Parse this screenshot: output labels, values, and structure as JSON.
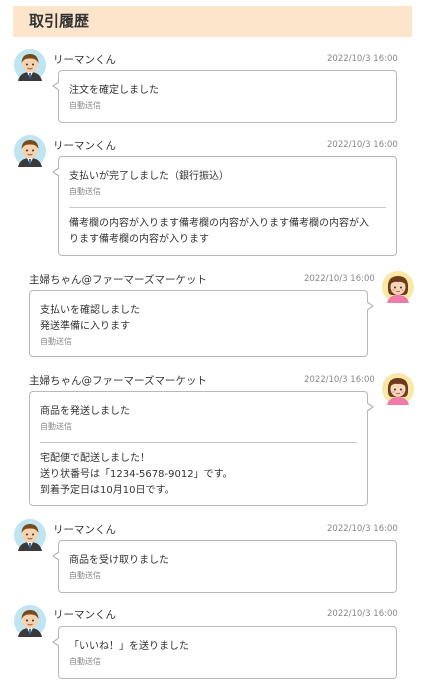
{
  "header": {
    "title": "取引履歴"
  },
  "messages": [
    {
      "sender": "リーマンくん",
      "time": "2022/10/3 16:00",
      "text": "注文を確定しました",
      "auto": "自動送信"
    },
    {
      "sender": "リーマンくん",
      "time": "2022/10/3 16:00",
      "text": "支払いが完了しました（銀行振込）",
      "auto": "自動送信",
      "note": "備考欄の内容が入ります備考欄の内容が入ります備考欄の内容が入\nります備考欄の内容が入ります"
    },
    {
      "sender": "主婦ちゃん@ファーマーズマーケット",
      "time": "2022/10/3 16:00",
      "text": "支払いを確認しました\n発送準備に入ります",
      "auto": "自動送信"
    },
    {
      "sender": "主婦ちゃん@ファーマーズマーケット",
      "time": "2022/10/3 16:00",
      "text": "商品を発送しました",
      "auto": "自動送信",
      "note": "宅配便で配送しました！\n送り状番号は「1234-5678-9012」です。\n到着予定日は10月10日です。"
    },
    {
      "sender": "リーマンくん",
      "time": "2022/10/3 16:00",
      "text": "商品を受け取りました",
      "auto": "自動送信"
    },
    {
      "sender": "リーマンくん",
      "time": "2022/10/3 16:00",
      "text": "「いいね！」を送りました",
      "auto": "自動送信"
    }
  ],
  "avatars": {
    "buyer_icon": "businessman-avatar-icon",
    "seller_icon": "housewife-avatar-icon"
  }
}
